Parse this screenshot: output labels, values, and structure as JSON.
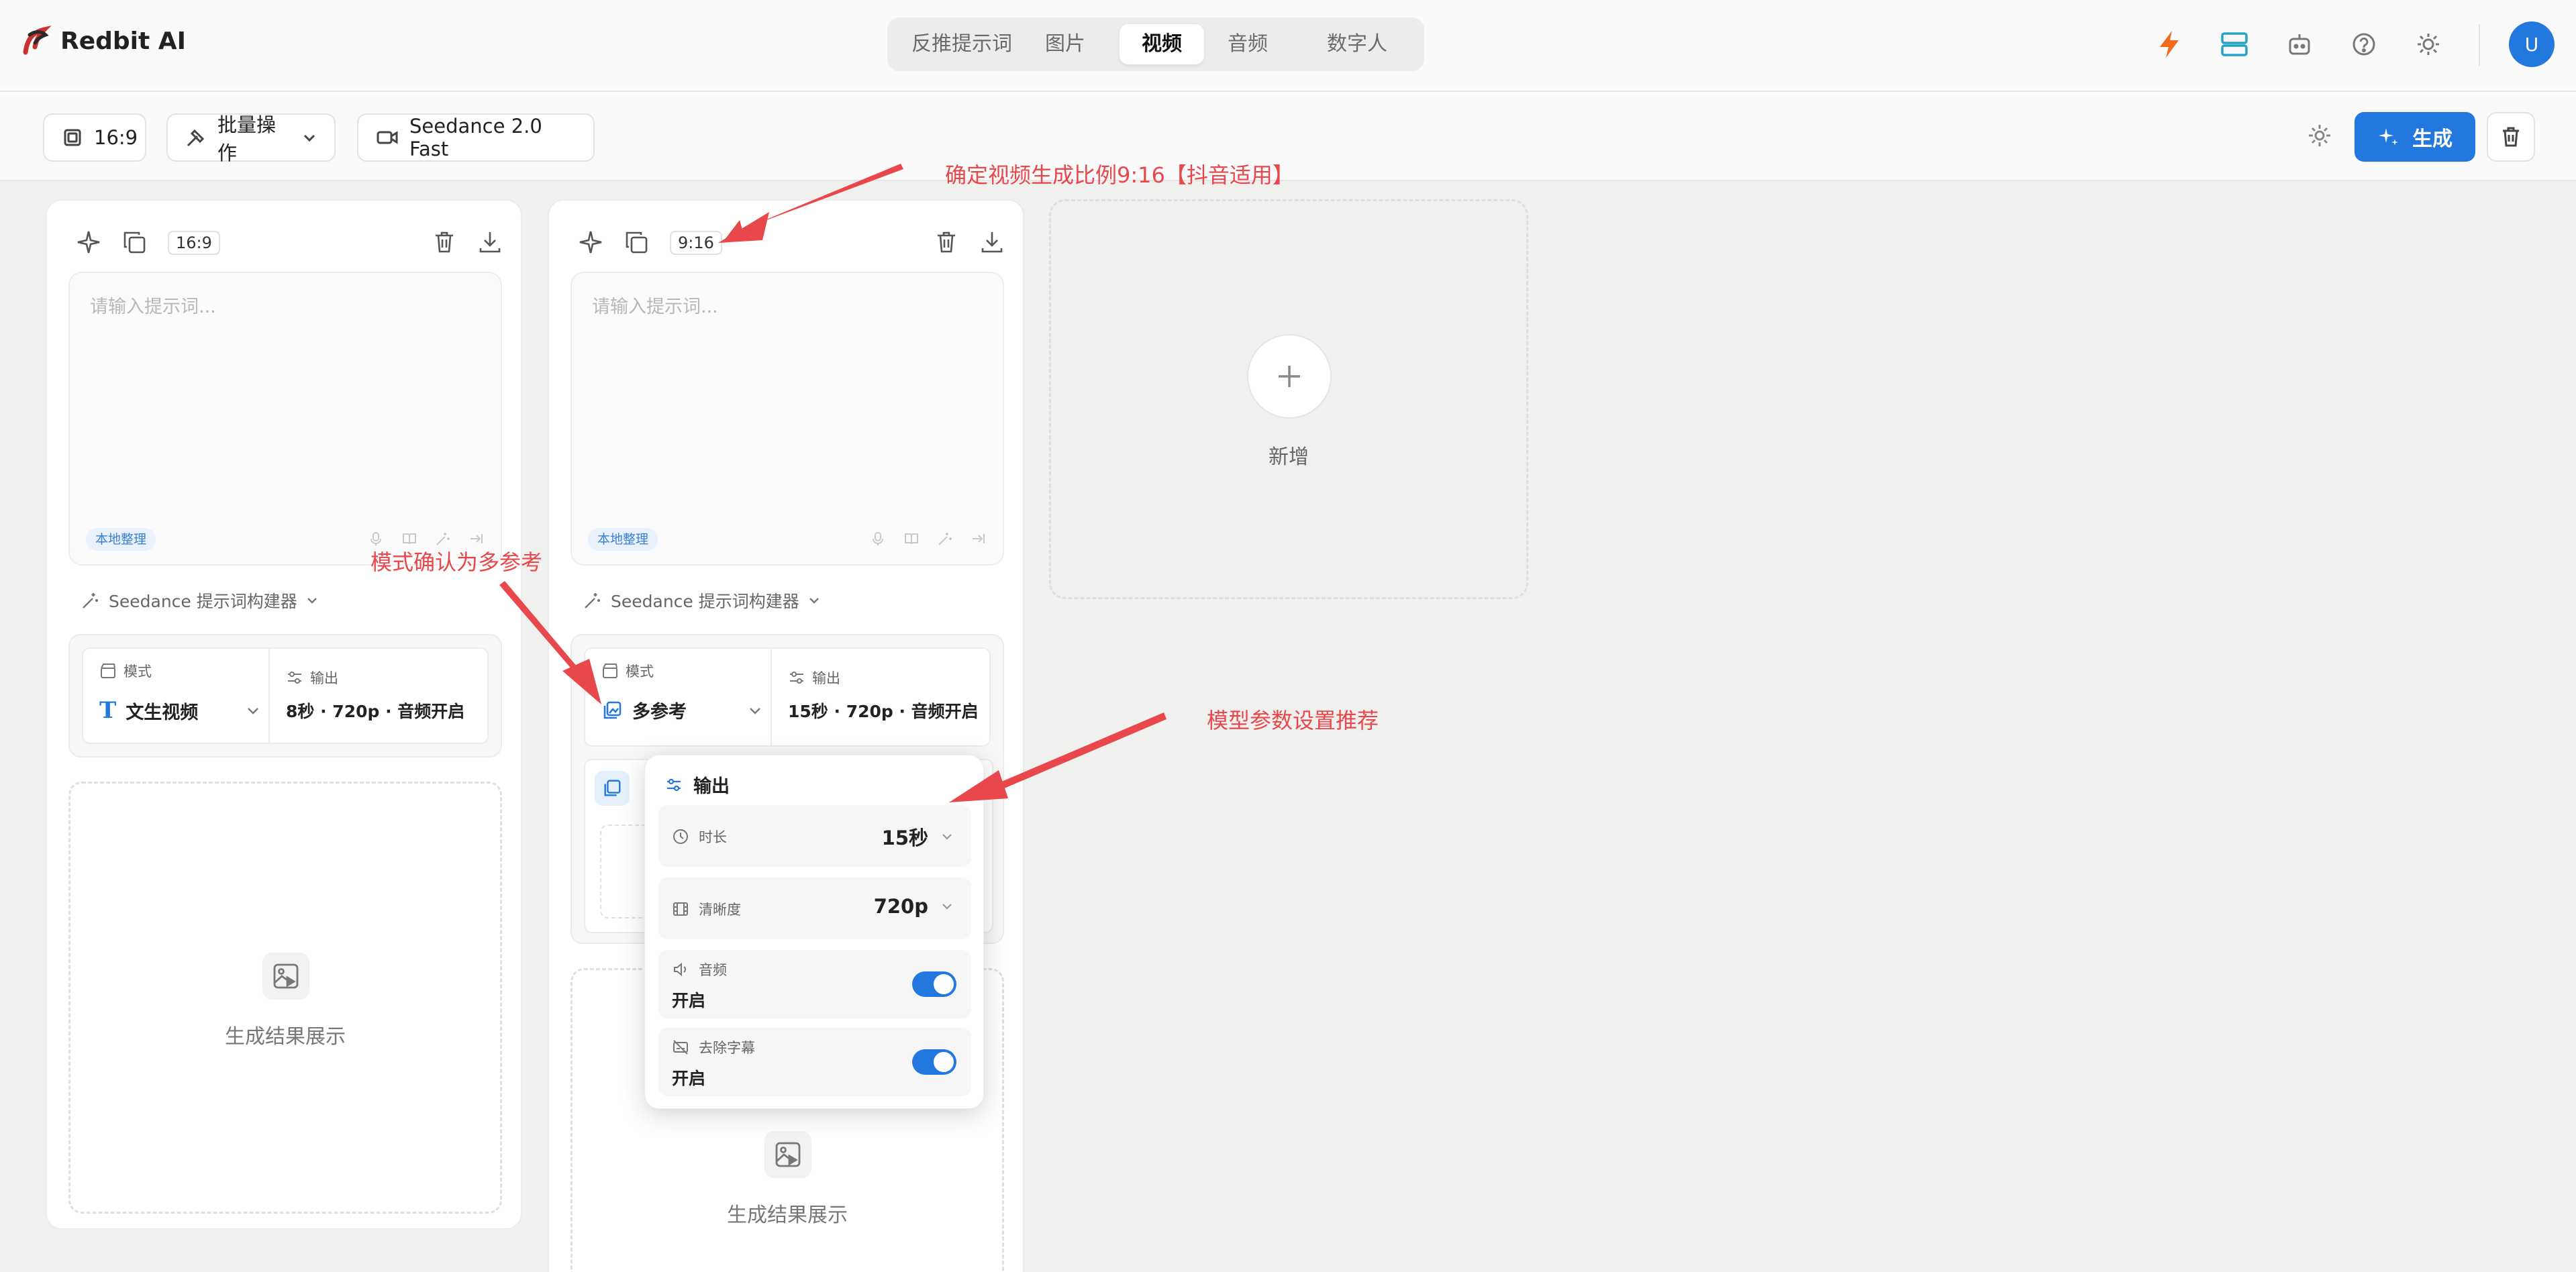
{
  "app": {
    "name": "Redbit AI"
  },
  "tabs": [
    {
      "label": "反推提示词",
      "active": false
    },
    {
      "label": "图片",
      "active": false
    },
    {
      "label": "视频",
      "active": true
    },
    {
      "label": "音频",
      "active": false
    },
    {
      "label": "数字人",
      "active": false
    }
  ],
  "header_icons": [
    "bolt-icon",
    "layers-icon",
    "robot-icon",
    "help-icon",
    "theme-icon"
  ],
  "user": {
    "avatar_letter": "U"
  },
  "toolbar": {
    "ratio_label": "16:9",
    "batch_label": "批量操作",
    "model_label": "Seedance 2.0 Fast",
    "generate_label": "生成"
  },
  "cards": [
    {
      "ratio": "16:9",
      "prompt_placeholder": "请输入提示词...",
      "local_tag": "本地整理",
      "builder_label": "Seedance 提示词构建器",
      "mode_label": "模式",
      "mode_value": "文生视频",
      "output_label": "输出",
      "output_value": "8秒 · 720p · 音频开启",
      "result_label": "生成结果展示"
    },
    {
      "ratio": "9:16",
      "prompt_placeholder": "请输入提示词...",
      "local_tag": "本地整理",
      "builder_label": "Seedance 提示词构建器",
      "mode_label": "模式",
      "mode_value": "多参考",
      "output_label": "输出",
      "output_value": "15秒 · 720p · 音频开启",
      "result_label": "生成结果展示"
    }
  ],
  "add_card": {
    "label": "新增"
  },
  "output_popup": {
    "title": "输出",
    "duration_label": "时长",
    "duration_value": "15秒",
    "resolution_label": "清晰度",
    "resolution_value": "720p",
    "audio_label": "音频",
    "audio_value": "开启",
    "audio_enabled": true,
    "subtitle_label": "去除字幕",
    "subtitle_value": "开启",
    "subtitle_enabled": true
  },
  "annotations": {
    "ratio_note": "确定视频生成比例9:16【抖音适用】",
    "mode_note": "模式确认为多参考",
    "params_note": "模型参数设置推荐"
  },
  "colors": {
    "accent": "#2378e0",
    "annotation": "#e8474c",
    "bolt": "#f26b1d"
  }
}
